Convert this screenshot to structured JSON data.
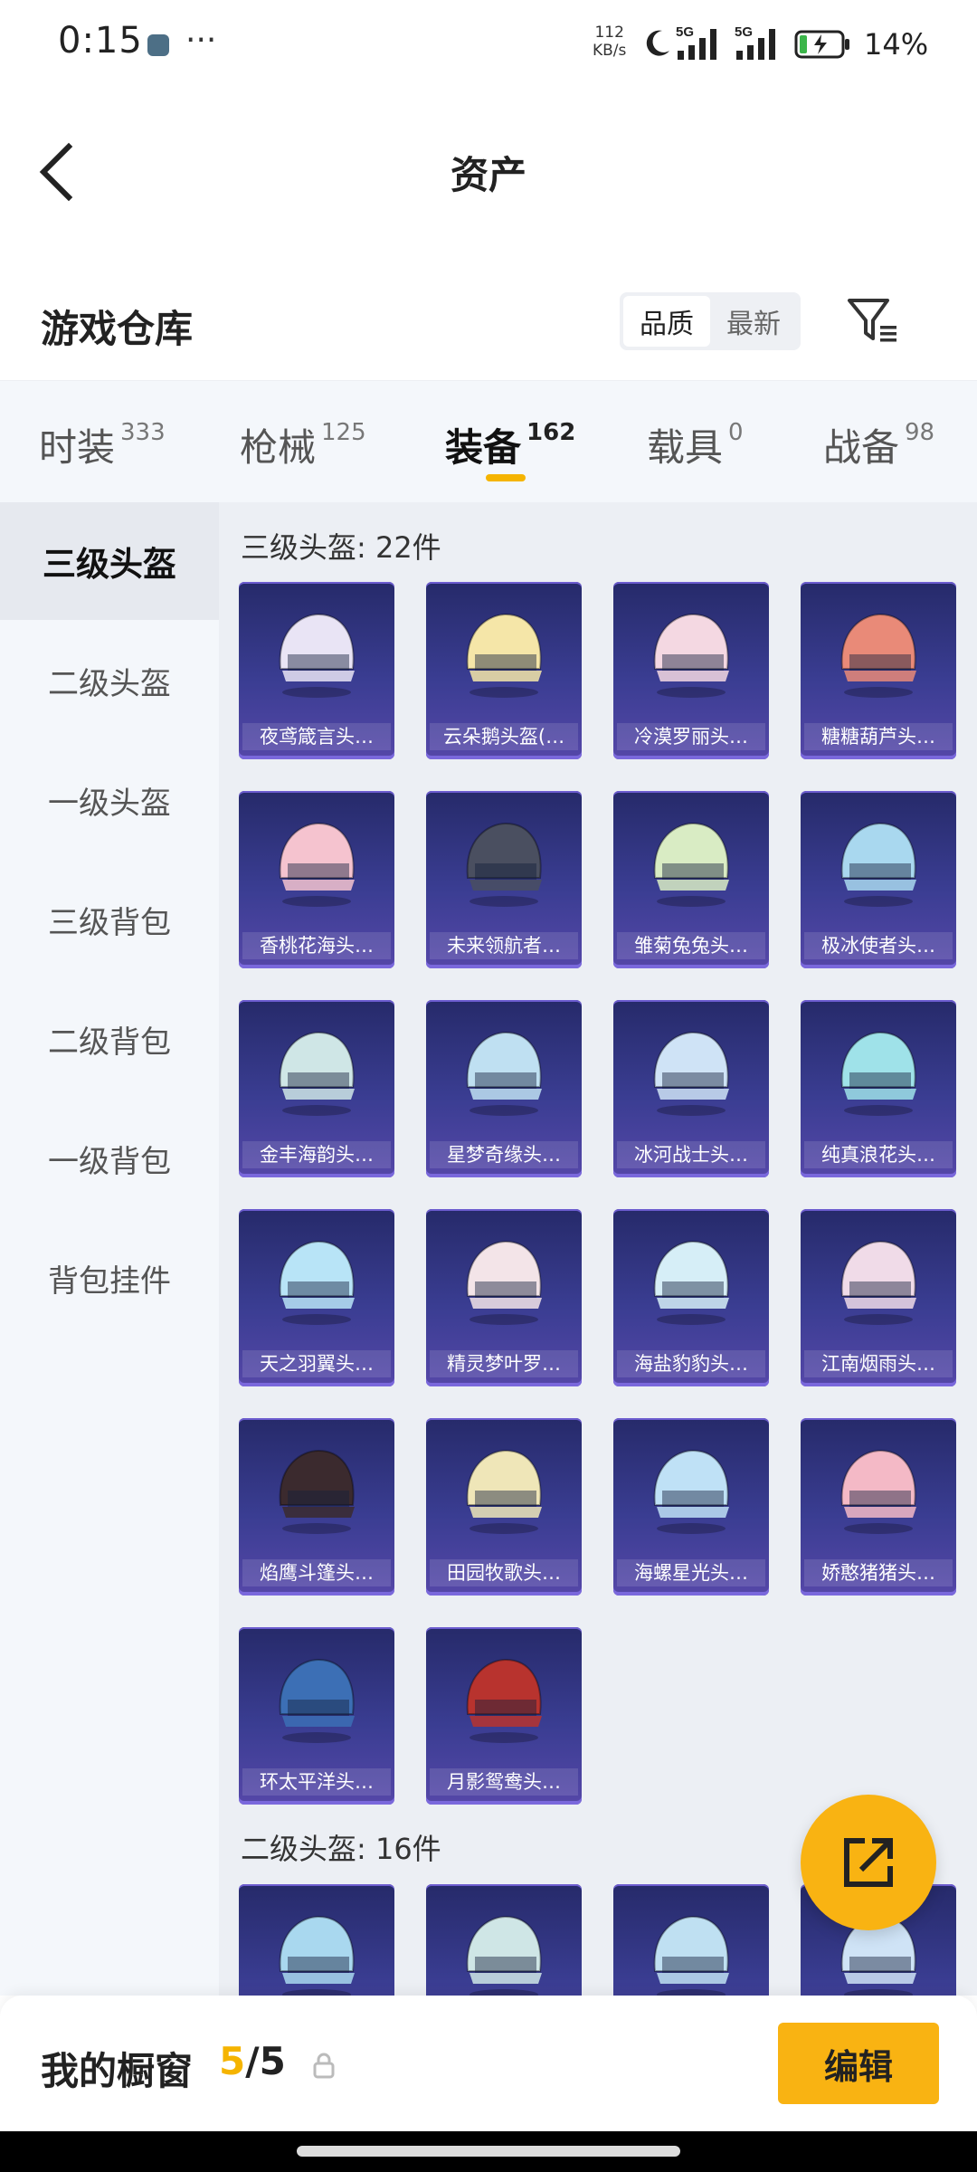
{
  "status_bar": {
    "time": "0:15",
    "speed_value": "112",
    "speed_unit": "KB/s",
    "network1": "5G",
    "network2": "5G",
    "battery": "14%"
  },
  "header": {
    "title": "资产"
  },
  "warehouse": {
    "title": "游戏仓库",
    "sort_options": [
      "品质",
      "最新"
    ],
    "sort_selected": "品质"
  },
  "tabs": [
    {
      "label": "时装",
      "count": "333"
    },
    {
      "label": "枪械",
      "count": "125"
    },
    {
      "label": "装备",
      "count": "162"
    },
    {
      "label": "载具",
      "count": "0"
    },
    {
      "label": "战备",
      "count": "98"
    }
  ],
  "active_tab": "装备",
  "sidebar": {
    "items": [
      "三级头盔",
      "二级头盔",
      "一级头盔",
      "三级背包",
      "二级背包",
      "一级背包",
      "背包挂件"
    ],
    "active": "三级头盔"
  },
  "sections": [
    {
      "title": "三级头盔: 22件",
      "items": [
        "夜鸢箴言头…",
        "云朵鹅头盔(…",
        "冷漠罗丽头…",
        "糖糖葫芦头…",
        "香桃花海头…",
        "未来领航者…",
        "雏菊兔兔头…",
        "极冰使者头…",
        "金丰海韵头…",
        "星梦奇缘头…",
        "冰河战士头…",
        "纯真浪花头…",
        "天之羽翼头…",
        "精灵梦叶罗…",
        "海盐豹豹头…",
        "江南烟雨头…",
        "焰鹰斗篷头…",
        "田园牧歌头…",
        "海螺星光头…",
        "娇憨猪猪头…",
        "环太平洋头…",
        "月影鸳鸯头…"
      ]
    },
    {
      "title": "二级头盔: 16件",
      "items": [
        "",
        "",
        "",
        ""
      ]
    }
  ],
  "showcase": {
    "label": "我的橱窗",
    "current": "5",
    "separator": "/",
    "total": "5"
  },
  "edit_button": "编辑",
  "colors": {
    "accent": "#f9b312",
    "card_top": "#262a6a",
    "card_bottom": "#5547a8"
  },
  "icons": [
    "back-arrow-icon",
    "filter-icon",
    "share-export-icon",
    "lock-icon"
  ]
}
